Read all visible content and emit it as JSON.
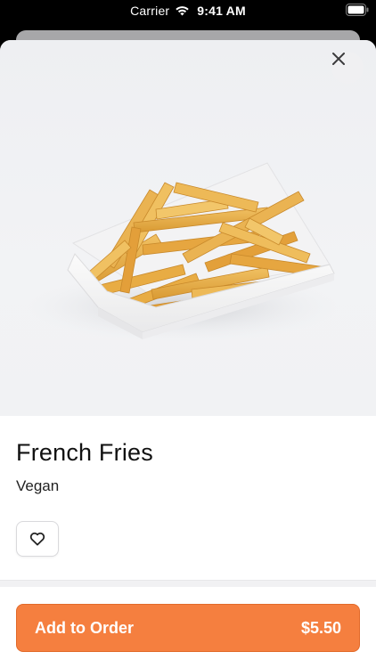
{
  "status_bar": {
    "carrier": "Carrier",
    "time": "9:41 AM",
    "wifi_icon": "wifi-icon",
    "battery_icon": "battery-icon"
  },
  "product": {
    "image_icon": "french-fries-photo",
    "name": "French Fries",
    "tag": "Vegan"
  },
  "actions": {
    "close_icon": "close-icon",
    "favorite_icon": "heart-outline-icon",
    "add_to_order_label": "Add to Order",
    "price": "$5.50"
  },
  "colors": {
    "accent": "#f57f3f",
    "text": "#111111",
    "photo_background": "#f0f1f3"
  }
}
